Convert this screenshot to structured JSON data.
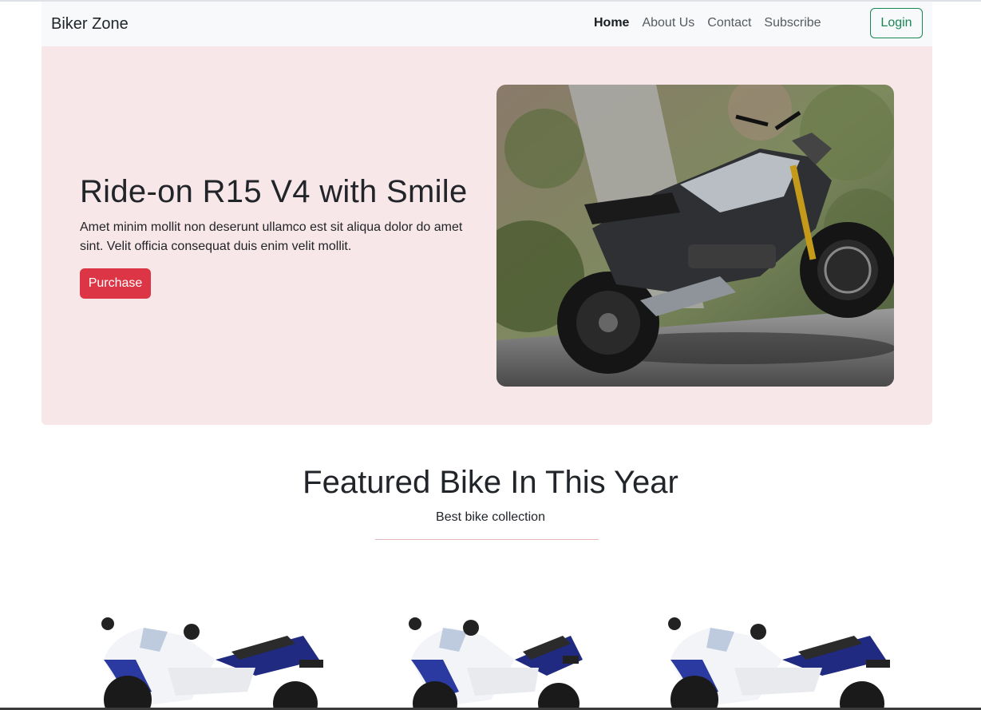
{
  "navbar": {
    "brand": "Biker Zone",
    "links": [
      {
        "label": "Home",
        "active": true
      },
      {
        "label": "About Us",
        "active": false
      },
      {
        "label": "Contact",
        "active": false
      },
      {
        "label": "Subscribe",
        "active": false
      }
    ],
    "login_label": "Login"
  },
  "hero": {
    "title": "Ride-on R15 V4 with Smile",
    "text": "Amet minim mollit non deserunt ullamco est sit aliqua dolor do amet sint. Velit officia consequat duis enim velit mollit.",
    "button_label": "Purchase",
    "image_icon": "motorcycle-photo"
  },
  "featured": {
    "title": "Featured Bike In This Year",
    "subtitle": "Best bike collection",
    "items": [
      {
        "image_icon": "sport-bike-image"
      },
      {
        "image_icon": "sport-bike-image"
      },
      {
        "image_icon": "sport-bike-image"
      }
    ]
  },
  "colors": {
    "hero_bg": "#f8e7e8",
    "primary_danger": "#dc3545",
    "success": "#198754",
    "navbar_bg": "#f8f9fa"
  }
}
